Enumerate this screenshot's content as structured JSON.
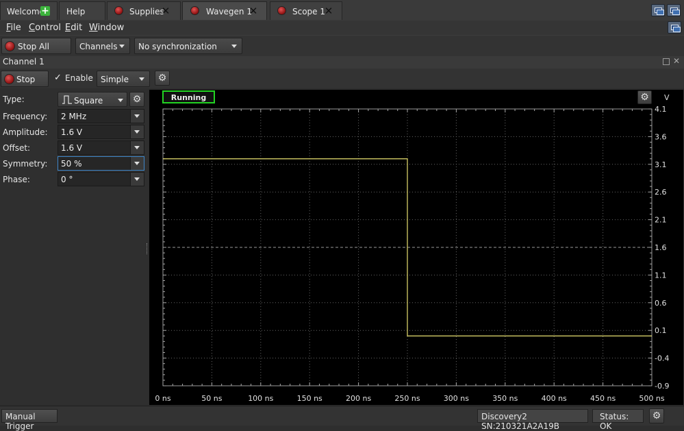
{
  "tabs": {
    "welcome": "Welcome",
    "help": "Help",
    "supplies": "Supplies",
    "wavegen": "Wavegen 1",
    "scope": "Scope 1"
  },
  "menu": {
    "file": {
      "first": "F",
      "rest": "ile"
    },
    "control": {
      "first": "C",
      "rest": "ontrol"
    },
    "edit": {
      "first": "E",
      "rest": "dit"
    },
    "window": {
      "first": "W",
      "rest": "indow"
    }
  },
  "toolbar": {
    "stop_all": "Stop All",
    "channels": "Channels",
    "sync": "No synchronization"
  },
  "channel": {
    "title": "Channel 1",
    "stop": "Stop",
    "enable": "Enable",
    "enable_checked": "✓",
    "mode": "Simple"
  },
  "params": {
    "type_label": "Type:",
    "type_value": "Square",
    "frequency_label": "Frequency:",
    "frequency_value": "2 MHz",
    "amplitude_label": "Amplitude:",
    "amplitude_value": "1.6 V",
    "offset_label": "Offset:",
    "offset_value": "1.6 V",
    "symmetry_label": "Symmetry:",
    "symmetry_value": "50 %",
    "phase_label": "Phase:",
    "phase_value": "0 °"
  },
  "plot": {
    "status": "Running",
    "y_unit": "V",
    "signal_color": "#e8e070",
    "status_color": "#22d422"
  },
  "chart_data": {
    "type": "line",
    "ylabel": "V",
    "y_ticks": [
      "4.1",
      "3.6",
      "3.1",
      "2.6",
      "2.1",
      "1.6",
      "1.1",
      "0.6",
      "0.1",
      "-0.4",
      "-0.9"
    ],
    "x_ticks": [
      "0 ns",
      "50 ns",
      "100 ns",
      "150 ns",
      "200 ns",
      "250 ns",
      "300 ns",
      "350 ns",
      "400 ns",
      "450 ns",
      "500 ns"
    ],
    "xlim": [
      0,
      500
    ],
    "ylim": [
      -0.9,
      4.1
    ],
    "series": [
      {
        "x": [
          0,
          250,
          250,
          500
        ],
        "y": [
          3.2,
          3.2,
          0.0,
          0.0
        ]
      }
    ]
  },
  "status": {
    "manual_trigger": "Manual Trigger",
    "device": "Discovery2 SN:210321A2A19B",
    "state": "Status: OK"
  }
}
